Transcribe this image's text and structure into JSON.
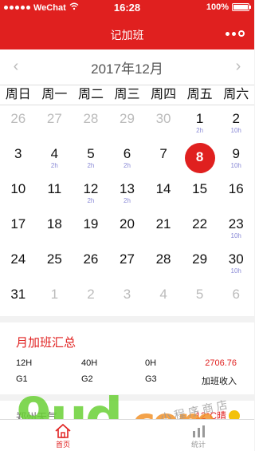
{
  "status_bar": {
    "carrier": "WeChat",
    "time": "16:28",
    "battery": "100%"
  },
  "nav": {
    "title": "记加班",
    "menu_icon": "more-dots-icon"
  },
  "calendar": {
    "month_label": "2017年12月",
    "weekdays": [
      "周日",
      "周一",
      "周二",
      "周三",
      "周四",
      "周五",
      "周六"
    ],
    "days": [
      {
        "num": "26",
        "hours": "",
        "other": true
      },
      {
        "num": "27",
        "hours": "",
        "other": true
      },
      {
        "num": "28",
        "hours": "",
        "other": true
      },
      {
        "num": "29",
        "hours": "",
        "other": true
      },
      {
        "num": "30",
        "hours": "",
        "other": true
      },
      {
        "num": "1",
        "hours": "2h",
        "other": false
      },
      {
        "num": "2",
        "hours": "10h",
        "other": false
      },
      {
        "num": "3",
        "hours": "",
        "other": false
      },
      {
        "num": "4",
        "hours": "2h",
        "other": false
      },
      {
        "num": "5",
        "hours": "2h",
        "other": false
      },
      {
        "num": "6",
        "hours": "2h",
        "other": false
      },
      {
        "num": "7",
        "hours": "",
        "other": false
      },
      {
        "num": "8",
        "hours": "",
        "other": false,
        "today": true
      },
      {
        "num": "9",
        "hours": "10h",
        "other": false
      },
      {
        "num": "10",
        "hours": "",
        "other": false
      },
      {
        "num": "11",
        "hours": "",
        "other": false
      },
      {
        "num": "12",
        "hours": "2h",
        "other": false
      },
      {
        "num": "13",
        "hours": "2h",
        "other": false
      },
      {
        "num": "14",
        "hours": "",
        "other": false
      },
      {
        "num": "15",
        "hours": "",
        "other": false
      },
      {
        "num": "16",
        "hours": "",
        "other": false
      },
      {
        "num": "17",
        "hours": "",
        "other": false
      },
      {
        "num": "18",
        "hours": "",
        "other": false
      },
      {
        "num": "19",
        "hours": "",
        "other": false
      },
      {
        "num": "20",
        "hours": "",
        "other": false
      },
      {
        "num": "21",
        "hours": "",
        "other": false
      },
      {
        "num": "22",
        "hours": "",
        "other": false
      },
      {
        "num": "23",
        "hours": "10h",
        "other": false
      },
      {
        "num": "24",
        "hours": "",
        "other": false
      },
      {
        "num": "25",
        "hours": "",
        "other": false
      },
      {
        "num": "26",
        "hours": "",
        "other": false
      },
      {
        "num": "27",
        "hours": "",
        "other": false
      },
      {
        "num": "28",
        "hours": "",
        "other": false
      },
      {
        "num": "29",
        "hours": "",
        "other": false
      },
      {
        "num": "30",
        "hours": "10h",
        "other": false
      },
      {
        "num": "31",
        "hours": "",
        "other": false
      },
      {
        "num": "1",
        "hours": "",
        "other": true
      },
      {
        "num": "2",
        "hours": "",
        "other": true
      },
      {
        "num": "3",
        "hours": "",
        "other": true
      },
      {
        "num": "4",
        "hours": "",
        "other": true
      },
      {
        "num": "5",
        "hours": "",
        "other": true
      },
      {
        "num": "6",
        "hours": "",
        "other": true
      }
    ]
  },
  "summary": {
    "title": "月加班汇总",
    "g1_value": "12H",
    "g1_label": "G1",
    "g2_value": "40H",
    "g2_label": "G2",
    "g3_value": "0H",
    "g3_label": "G3",
    "income_value": "2706.76",
    "income_label": "加班收入"
  },
  "weather": {
    "city": "郑州天气",
    "temp": "12°C晴"
  },
  "watermark": {
    "brand": "9ud",
    "suffix": ".com",
    "tagline": "小程序商店"
  },
  "tabbar": {
    "home_label": "首页",
    "stats_label": "统计"
  },
  "colors": {
    "accent": "#e0201f",
    "hours": "#8a8ad6",
    "muted": "#bbbbbb"
  }
}
